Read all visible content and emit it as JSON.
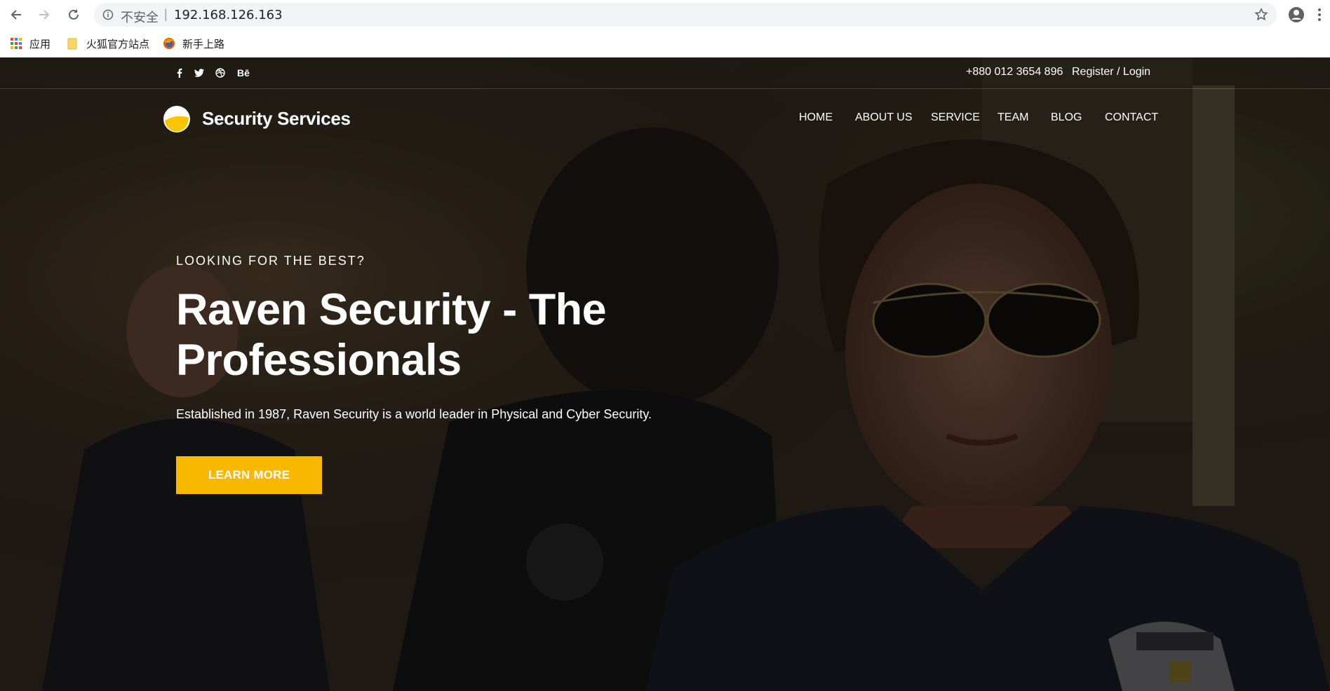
{
  "browser": {
    "security_label": "不安全",
    "separator": "|",
    "url": "192.168.126.163",
    "bookmarks": [
      {
        "label": "应用",
        "icon": "apps-grid-icon"
      },
      {
        "label": "火狐官方站点",
        "icon": "folder-icon"
      },
      {
        "label": "新手上路",
        "icon": "firefox-icon"
      }
    ]
  },
  "topbar": {
    "social": [
      {
        "label": "",
        "icon": "facebook-icon"
      },
      {
        "label": "",
        "icon": "twitter-icon"
      },
      {
        "label": "",
        "icon": "dribbble-icon"
      },
      {
        "label": "Bē",
        "icon": "behance-icon"
      }
    ],
    "phone": "+880 012 3654 896",
    "login": "Register / Login"
  },
  "header": {
    "logo_text": "Security Services",
    "nav": [
      "HOME",
      "ABOUT US",
      "SERVICE",
      "TEAM",
      "BLOG",
      "CONTACT"
    ]
  },
  "hero": {
    "eyebrow": "LOOKING FOR THE BEST?",
    "title_line1": "Raven Security - The",
    "title_line2": "Professionals",
    "subtitle": "Established in 1987, Raven Security is a world leader in Physical and Cyber Security.",
    "cta_label": "LEARN MORE"
  },
  "colors": {
    "accent": "#f9b800",
    "text_light": "#ffffff",
    "chrome_bg": "#f1f3f4"
  }
}
